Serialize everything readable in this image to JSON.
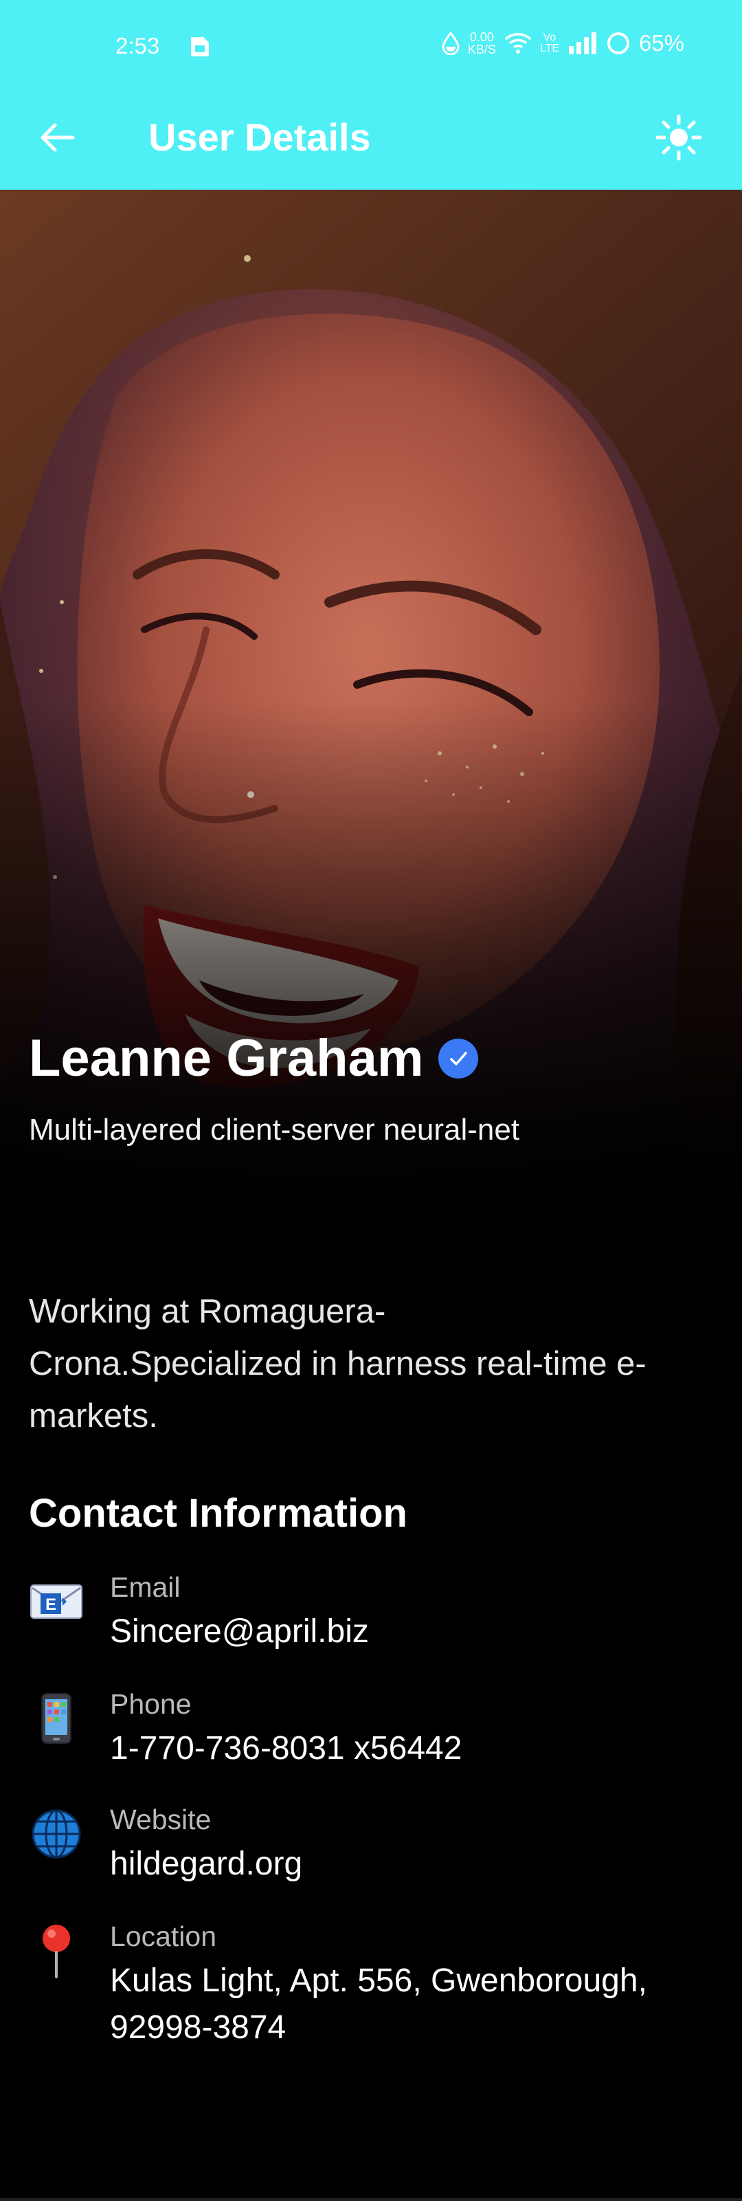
{
  "status_bar": {
    "time": "2:53",
    "net_speed_value": "0.00",
    "net_speed_unit": "KB/S",
    "network_type": "Vo LTE",
    "battery": "65%"
  },
  "app_bar": {
    "title": "User Details",
    "back_icon": "arrow-left-icon",
    "theme_icon": "sun-icon",
    "background_color": "#4ef0f5"
  },
  "profile": {
    "name": "Leanne Graham",
    "verified": true,
    "verified_color": "#3b7af5",
    "tagline": "Multi-layered client-server neural-net",
    "bio": "Working at Romaguera-Crona.Specialized in harness real-time e-markets."
  },
  "contact": {
    "heading": "Contact Information",
    "items": [
      {
        "icon": "envelope-icon",
        "label": "Email",
        "value": "Sincere@april.biz"
      },
      {
        "icon": "mobile-phone-icon",
        "label": "Phone",
        "value": "1-770-736-8031 x56442"
      },
      {
        "icon": "globe-icon",
        "label": "Website",
        "value": "hildegard.org"
      },
      {
        "icon": "location-pin-icon",
        "label": "Location",
        "value": "Kulas Light, Apt. 556, Gwenborough, 92998-3874"
      }
    ]
  }
}
